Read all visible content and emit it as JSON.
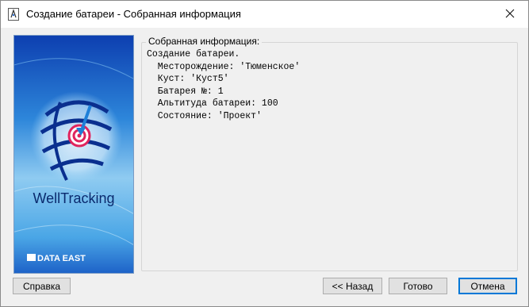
{
  "window": {
    "title": "Создание батареи - Собранная информация",
    "app_icon": "app-wizard-icon",
    "close_icon": "close-icon"
  },
  "banner": {
    "brand_name": "WellTracking",
    "company_name": "DATA EAST",
    "colors": {
      "top": "#0d3fb0",
      "mid": "#4aa6e6",
      "bottom": "#1e63c8",
      "target": "#e0245e"
    }
  },
  "summary": {
    "legend": "Собранная информация:",
    "lines": [
      "Создание батареи.",
      "  Месторождение: 'Тюменское'",
      "  Куст: 'Куст5'",
      "  Батарея №: 1",
      "  Альтитуда батареи: 100",
      "  Состояние: 'Проект'"
    ]
  },
  "buttons": {
    "help": "Справка",
    "back": "<< Назад",
    "finish": "Готово",
    "cancel": "Отмена"
  }
}
